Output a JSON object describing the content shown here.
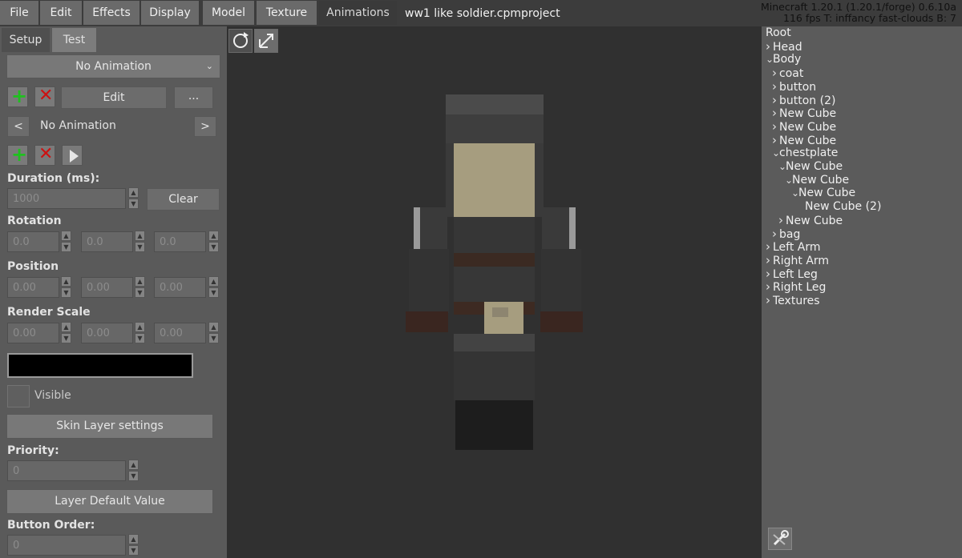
{
  "menu": {
    "items": [
      "File",
      "Edit",
      "Effects",
      "Display",
      "Model",
      "Texture",
      "Animations"
    ],
    "active": "Animations"
  },
  "project_title": "ww1 like soldier.cpmproject",
  "debug": {
    "line1": "Minecraft 1.20.1 (1.20.1/forge) 0.6.10a",
    "line2": "116 fps T: inffancy fast-clouds B: 7"
  },
  "left": {
    "tabs": [
      "Setup",
      "Test"
    ],
    "animation_select": "No Animation",
    "edit_label": "Edit",
    "more_label": "...",
    "nav_prev": "<",
    "nav_next": ">",
    "nav_current": "No Animation",
    "duration_label": "Duration (ms):",
    "duration_value": "1000",
    "clear_label": "Clear",
    "rotation_label": "Rotation",
    "rotation": [
      "0.0",
      "0.0",
      "0.0"
    ],
    "position_label": "Position",
    "position": [
      "0.00",
      "0.00",
      "0.00"
    ],
    "scale_label": "Render Scale",
    "scale": [
      "0.00",
      "0.00",
      "0.00"
    ],
    "color_value": "#000000",
    "visible_label": "Visible",
    "skin_layer_label": "Skin Layer settings",
    "priority_label": "Priority:",
    "priority_value": "0",
    "layer_default_label": "Layer Default Value",
    "button_order_label": "Button Order:",
    "button_order_value": "0"
  },
  "tree": [
    {
      "label": "Root",
      "arrow": "",
      "depth": 0
    },
    {
      "label": "Head",
      "arrow": ">",
      "depth": 0
    },
    {
      "label": "Body",
      "arrow": "v",
      "depth": 0
    },
    {
      "label": "coat",
      "arrow": ">",
      "depth": 1
    },
    {
      "label": "button",
      "arrow": ">",
      "depth": 1
    },
    {
      "label": "button (2)",
      "arrow": ">",
      "depth": 1
    },
    {
      "label": "New Cube",
      "arrow": ">",
      "depth": 1
    },
    {
      "label": "New Cube",
      "arrow": ">",
      "depth": 1
    },
    {
      "label": "New Cube",
      "arrow": ">",
      "depth": 1
    },
    {
      "label": "chestplate",
      "arrow": "v",
      "depth": 1
    },
    {
      "label": "New Cube",
      "arrow": "v",
      "depth": 2
    },
    {
      "label": "New Cube",
      "arrow": "v",
      "depth": 3
    },
    {
      "label": "New Cube",
      "arrow": "v",
      "depth": 4
    },
    {
      "label": "New Cube (2)",
      "arrow": "",
      "depth": 5
    },
    {
      "label": "New Cube",
      "arrow": ">",
      "depth": 2
    },
    {
      "label": "bag",
      "arrow": ">",
      "depth": 1
    },
    {
      "label": "Left Arm",
      "arrow": ">",
      "depth": 0
    },
    {
      "label": "Right Arm",
      "arrow": ">",
      "depth": 0
    },
    {
      "label": "Left Leg",
      "arrow": ">",
      "depth": 0
    },
    {
      "label": "Right Leg",
      "arrow": ">",
      "depth": 0
    },
    {
      "label": "Textures",
      "arrow": ">",
      "depth": 0
    }
  ],
  "icons": {
    "add": "plus-icon",
    "delete": "x-icon",
    "play": "play-icon",
    "rotate_view": "rotate-icon",
    "pan_view": "move-icon",
    "settings": "wrench-icon"
  },
  "colors": {
    "add_green": "#1fc01f",
    "delete_red": "#cc1111",
    "helmet": "#4a4a4a",
    "face": "#a69d7f",
    "uniform": "#3b3b3b",
    "belt": "#3c2a22",
    "buckle": "#a69d7f",
    "boots": "#1d1d1d",
    "sleeve_white": "#9a9a9a",
    "cuff_brown": "#3a2620"
  }
}
